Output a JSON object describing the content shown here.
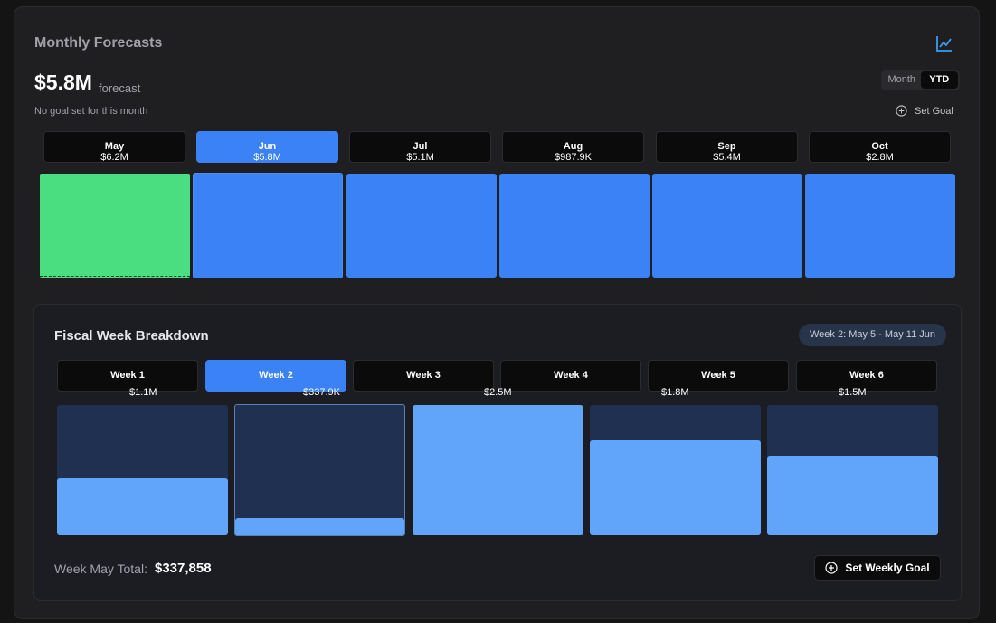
{
  "header": {
    "title": "Monthly Forecasts",
    "chart_icon": "line-chart-icon",
    "accent": "#3b82f6"
  },
  "summary": {
    "value": "$5.8M",
    "sub": "forecast",
    "goal_note": "No goal set for this month",
    "set_goal_label": "Set Goal"
  },
  "toggle": {
    "options": [
      "Month",
      "YTD"
    ],
    "selected": "YTD"
  },
  "months": [
    {
      "name": "May",
      "value": "$6.2M",
      "bar_color": "#4ade80",
      "selected": false
    },
    {
      "name": "Jun",
      "value": "$5.8M",
      "bar_color": "#3b82f6",
      "selected": true
    },
    {
      "name": "Jul",
      "value": "$5.1M",
      "bar_color": "#3b82f6",
      "selected": false
    },
    {
      "name": "Aug",
      "value": "$987.9K",
      "bar_color": "#3b82f6",
      "selected": false
    },
    {
      "name": "Sep",
      "value": "$5.4M",
      "bar_color": "#3b82f6",
      "selected": false
    },
    {
      "name": "Oct",
      "value": "$2.8M",
      "bar_color": "#3b82f6",
      "selected": false
    }
  ],
  "fiscal": {
    "title": "Fiscal Week Breakdown",
    "range_pill": "Week 2: May 5 - May 11 Jun",
    "weeks": [
      {
        "label": "Week 1",
        "value": "$1.1M",
        "fill": 0.44,
        "selected": false
      },
      {
        "label": "Week 2",
        "value": "$337.9K",
        "fill": 0.13,
        "selected": true
      },
      {
        "label": "Week 3",
        "value": "$2.5M",
        "fill": 1.0,
        "selected": false
      },
      {
        "label": "Week 4",
        "value": "$1.8M",
        "fill": 0.73,
        "selected": false
      },
      {
        "label": "Week 5",
        "value": "$1.5M",
        "fill": 0.61,
        "selected": false
      }
    ],
    "week6_label": "Week 6",
    "total_label": "Week May Total:",
    "total_value": "$337,858",
    "weekly_goal_label": "Set Weekly Goal"
  }
}
